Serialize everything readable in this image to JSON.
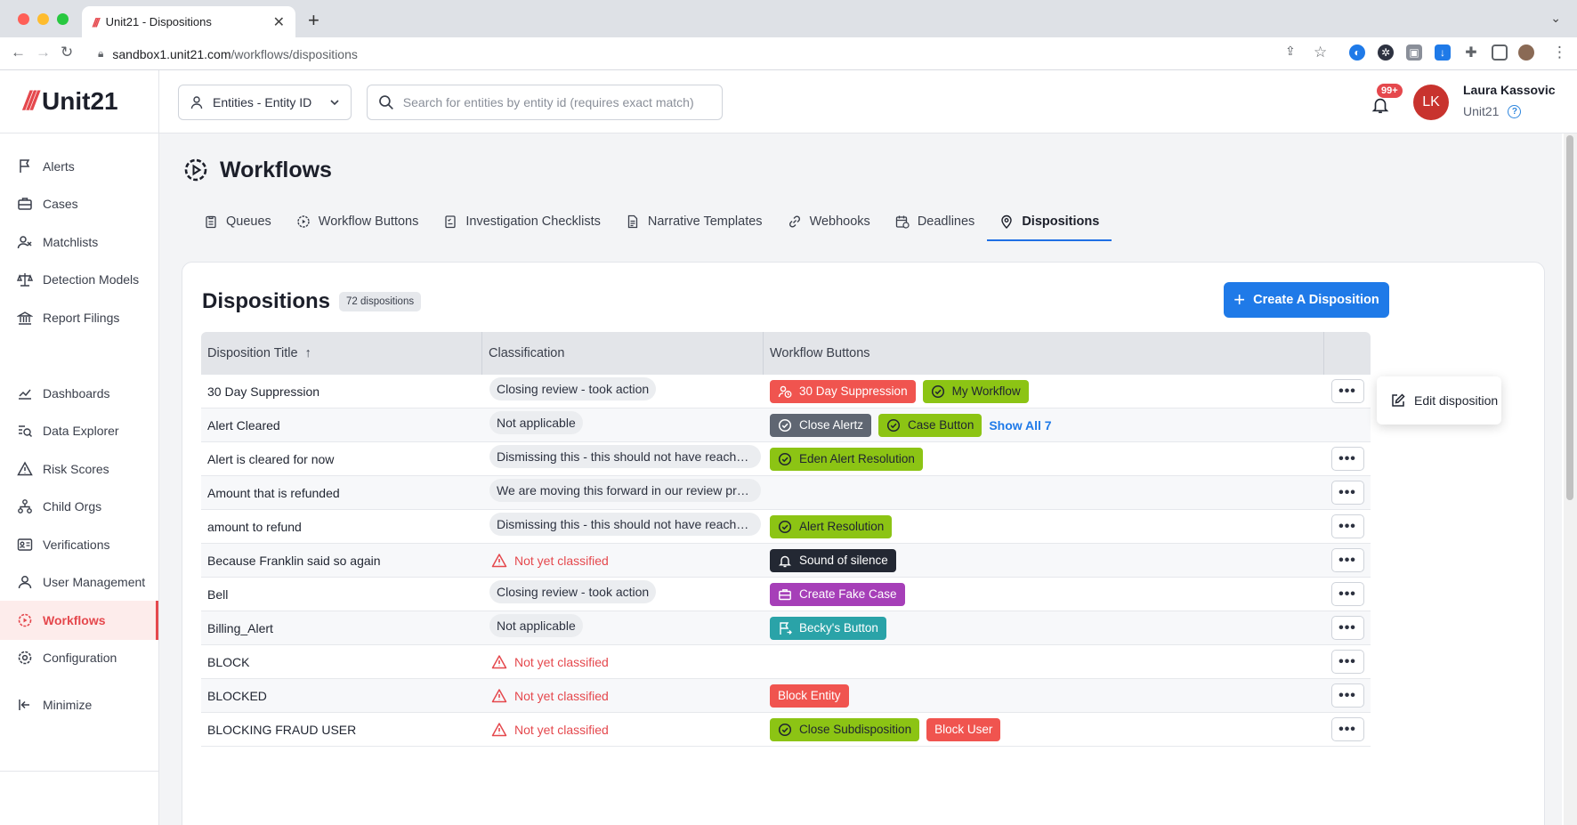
{
  "browser": {
    "tab_title": "Unit21 - Dispositions",
    "url_host": "sandbox1.unit21.com",
    "url_path": "/workflows/dispositions"
  },
  "header": {
    "logo_text": "Unit21",
    "entity_select": "Entities - Entity ID",
    "search_placeholder": "Search for entities by entity id (requires exact match)",
    "notification_count": "99+",
    "user_initials": "LK",
    "user_name": "Laura Kassovic",
    "user_org": "Unit21"
  },
  "sidebar": {
    "items": [
      {
        "label": "Alerts",
        "icon": "flag-icon"
      },
      {
        "label": "Cases",
        "icon": "briefcase-icon"
      },
      {
        "label": "Matchlists",
        "icon": "user-x-icon"
      },
      {
        "label": "Detection Models",
        "icon": "scale-icon"
      },
      {
        "label": "Report Filings",
        "icon": "bank-icon"
      },
      {
        "label": "Dashboards",
        "icon": "chart-line-icon"
      },
      {
        "label": "Data Explorer",
        "icon": "zoom-data-icon"
      },
      {
        "label": "Risk Scores",
        "icon": "warning-icon"
      },
      {
        "label": "Child Orgs",
        "icon": "hierarchy-icon"
      },
      {
        "label": "Verifications",
        "icon": "id-card-icon"
      },
      {
        "label": "User Management",
        "icon": "users-icon"
      },
      {
        "label": "Workflows",
        "icon": "gear-play-icon"
      },
      {
        "label": "Configuration",
        "icon": "gear-icon"
      }
    ],
    "active": "Workflows",
    "minimize_label": "Minimize"
  },
  "page": {
    "title": "Workflows",
    "tabs": [
      {
        "label": "Queues"
      },
      {
        "label": "Workflow Buttons"
      },
      {
        "label": "Investigation Checklists"
      },
      {
        "label": "Narrative Templates"
      },
      {
        "label": "Webhooks"
      },
      {
        "label": "Deadlines"
      },
      {
        "label": "Dispositions"
      }
    ],
    "active_tab": "Dispositions"
  },
  "dispositions": {
    "heading": "Dispositions",
    "count_label": "72 dispositions",
    "create_label": "Create A Disposition",
    "columns": [
      "Disposition Title",
      "Classification",
      "Workflow Buttons"
    ],
    "sort_indicator": "↑",
    "not_classified_label": "Not yet classified",
    "rows": [
      {
        "title": "30 Day Suppression",
        "classification": "Closing review - took action",
        "buttons": [
          {
            "label": "30 Day Suppression",
            "color": "#f0544f",
            "text": "#ffffff",
            "icon": "user-clock-icon"
          },
          {
            "label": "My Workflow",
            "color": "#8cc414",
            "text": "#1f2430",
            "icon": "check-circle-icon"
          }
        ]
      },
      {
        "title": "Alert Cleared",
        "classification": "Not applicable",
        "buttons": [
          {
            "label": "Close Alertz",
            "color": "#5f6672",
            "text": "#ffffff",
            "icon": "check-circle-icon"
          },
          {
            "label": "Case Button",
            "color": "#8cc414",
            "text": "#1f2430",
            "icon": "check-circle-icon"
          }
        ],
        "show_all": "Show All 7"
      },
      {
        "title": "Alert is cleared for now",
        "classification": "Dismissing this - this should not have reached this stage",
        "buttons": [
          {
            "label": "Eden Alert Resolution",
            "color": "#8cc414",
            "text": "#1f2430",
            "icon": "check-circle-icon"
          }
        ]
      },
      {
        "title": "Amount that is refunded",
        "classification": "We are moving this forward in our review process",
        "buttons": []
      },
      {
        "title": "amount to refund",
        "classification": "Dismissing this - this should not have reached this stage",
        "buttons": [
          {
            "label": "Alert Resolution",
            "color": "#8cc414",
            "text": "#1f2430",
            "icon": "check-circle-icon"
          }
        ]
      },
      {
        "title": "Because Franklin said so again",
        "classification": "",
        "buttons": [
          {
            "label": "Sound of silence",
            "color": "#232833",
            "text": "#ffffff",
            "icon": "bell-icon"
          }
        ]
      },
      {
        "title": "Bell",
        "classification": "Closing review - took action",
        "buttons": [
          {
            "label": "Create Fake Case",
            "color": "#a63fb8",
            "text": "#ffffff",
            "icon": "briefcase-icon"
          }
        ]
      },
      {
        "title": "Billing_Alert",
        "classification": "Not applicable",
        "buttons": [
          {
            "label": "Becky's Button",
            "color": "#2aa3a8",
            "text": "#ffffff",
            "icon": "flag-arrow-icon"
          }
        ]
      },
      {
        "title": "BLOCK",
        "classification": "",
        "buttons": []
      },
      {
        "title": "BLOCKED",
        "classification": "",
        "buttons": [
          {
            "label": "Block Entity",
            "color": "#f0544f",
            "text": "#ffffff",
            "icon": ""
          }
        ]
      },
      {
        "title": "BLOCKING FRAUD USER",
        "classification": "",
        "buttons": [
          {
            "label": "Close Subdisposition",
            "color": "#8cc414",
            "text": "#1f2430",
            "icon": "check-circle-icon"
          },
          {
            "label": "Block User",
            "color": "#f0544f",
            "text": "#ffffff",
            "icon": ""
          }
        ]
      }
    ],
    "row_menu": {
      "label": "Edit disposition"
    }
  },
  "colors": {
    "brand_red": "#e5484d",
    "primary_blue": "#1f7ae8"
  }
}
